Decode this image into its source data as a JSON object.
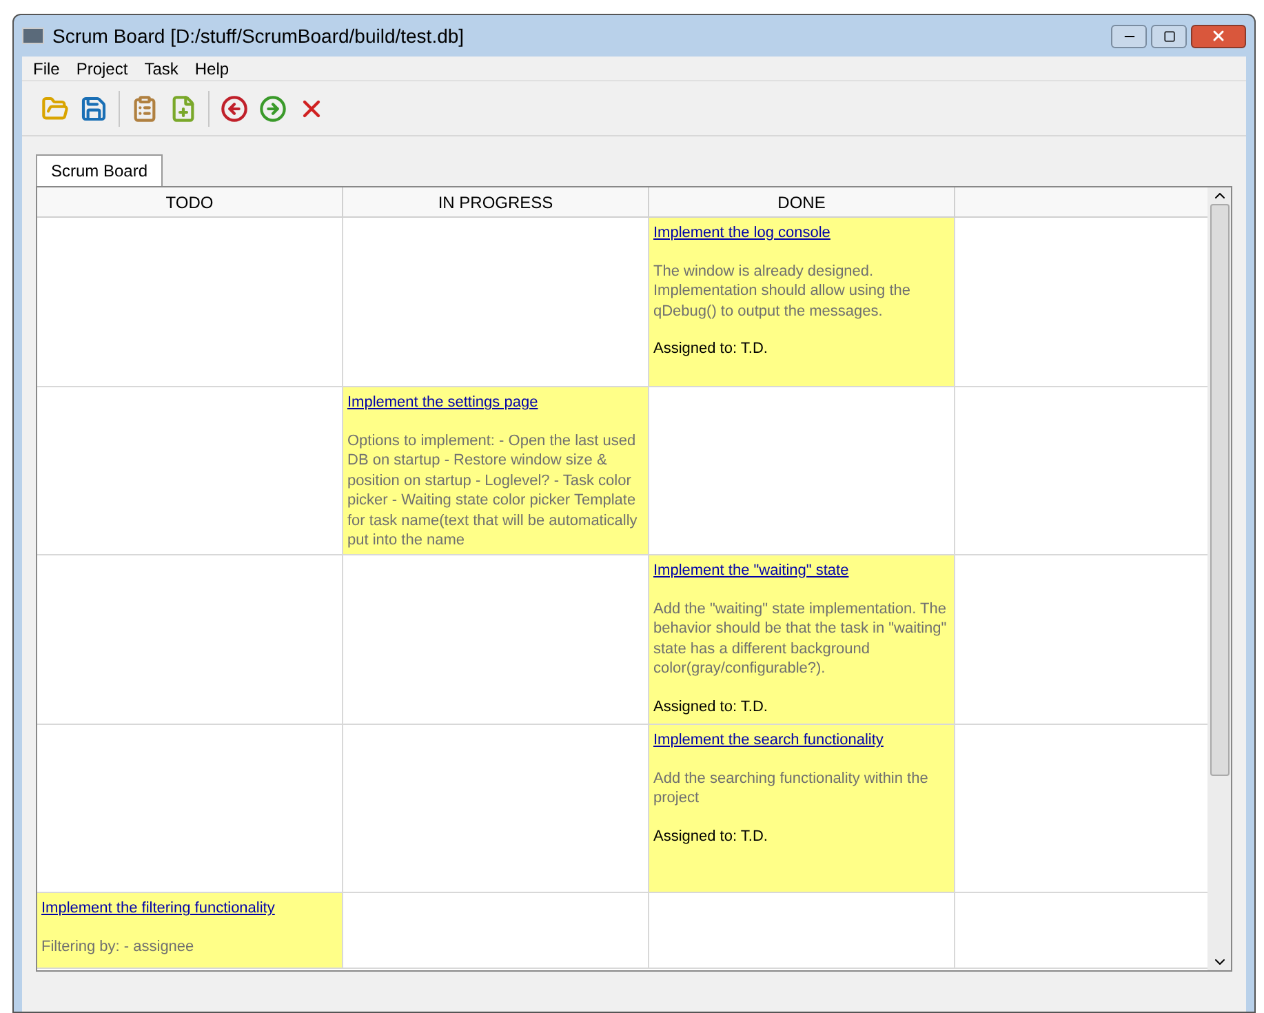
{
  "window": {
    "title": "Scrum Board [D:/stuff/ScrumBoard/build/test.db]"
  },
  "menu": [
    "File",
    "Project",
    "Task",
    "Help"
  ],
  "tabs": [
    {
      "label": "Scrum Board",
      "selected": true
    }
  ],
  "board": {
    "columns": [
      "TODO",
      "IN PROGRESS",
      "DONE"
    ],
    "rows": [
      {
        "cells": [
          {},
          {},
          {
            "title": "Implement the log console",
            "description": "The window is already designed. Implementation should allow using the qDebug() to output the messages.",
            "assignee": "Assigned to: T.D."
          }
        ]
      },
      {
        "cells": [
          {},
          {
            "title": "Implement the settings page",
            "description": "Options to implement: - Open the last used DB on startup - Restore window size & position on startup - Loglevel? - Task color picker - Waiting state color picker Template for task name(text that will be automatically put into the name"
          },
          {}
        ]
      },
      {
        "cells": [
          {},
          {},
          {
            "title": "Implement the \"waiting\" state",
            "description": "Add the \"waiting\" state implementation. The behavior should be that the task in \"waiting\" state has a different background color(gray/configurable?).",
            "assignee": "Assigned to: T.D."
          }
        ]
      },
      {
        "cells": [
          {},
          {},
          {
            "title": "Implement the search functionality",
            "description": "Add the searching functionality within the project",
            "assignee": "Assigned to: T.D."
          }
        ]
      },
      {
        "cells": [
          {
            "title": "Implement the filtering functionality",
            "description": "Filtering by: - assignee"
          },
          {},
          {}
        ]
      }
    ]
  }
}
